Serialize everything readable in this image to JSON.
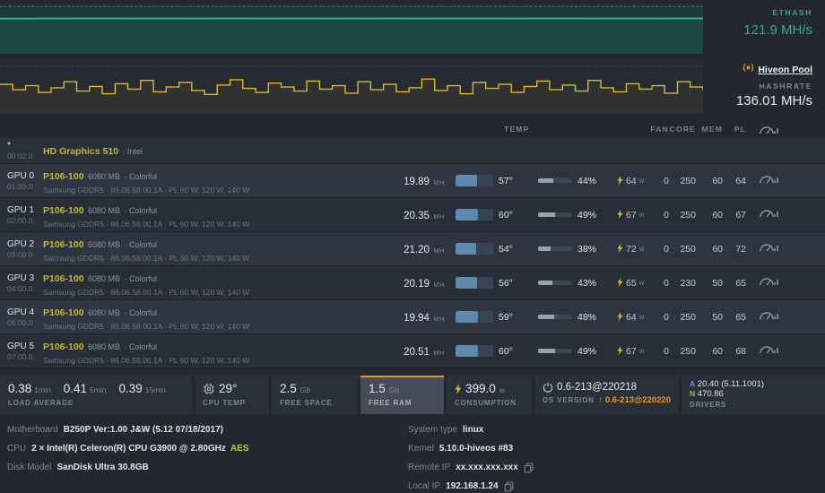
{
  "ethash": {
    "label": "ETHASH",
    "value": "121.9 MH/s",
    "chart": {
      "values": [
        121.5,
        122,
        121.8,
        122.2,
        121.9,
        122,
        121.7,
        122.1,
        121.9,
        122
      ],
      "ymin": 0,
      "ymax": 170,
      "color": "#2bb3a4",
      "fill": "rgba(43,179,164,0.12)"
    }
  },
  "pool": {
    "name": "Hiveon Pool",
    "hashrate_label": "HASHRATE",
    "hashrate": "136.01 MH/s",
    "chart": {
      "values": [
        139,
        131,
        137,
        127,
        134,
        143,
        129,
        136,
        125,
        140,
        132,
        145,
        128,
        135,
        142,
        130,
        124,
        138,
        146,
        133,
        127,
        141,
        135,
        129,
        144,
        132,
        137,
        126,
        143,
        131,
        139,
        128,
        134,
        147,
        130,
        137,
        125,
        142,
        133,
        139,
        127,
        136,
        144,
        131,
        138,
        129,
        145,
        134,
        128,
        140,
        132,
        137,
        126,
        143,
        135,
        130
      ],
      "ymin": 95,
      "ymax": 170,
      "color": "#e3b71c",
      "fill": "rgba(227,183,28,0.05)"
    }
  },
  "table": {
    "headers": {
      "temp": "TEMP",
      "fan": "FAN",
      "core": "CORE",
      "mem": "MEM",
      "pl": "PL"
    },
    "integrated": {
      "slot": "*",
      "bus": "00:02.0",
      "name": "HD Graphics 510",
      "vendor": "· Intel"
    },
    "gpus": [
      {
        "slot": "GPU 0",
        "bus": "01:00.0",
        "model": "P106-100",
        "memsize": "6080 MB",
        "brand": "· Colorful",
        "detail": "Samsung GDDR5 · 86.06.58.00.1A · PL 60 W, 120 W, 140 W",
        "hash": "19.89",
        "hash_unit": "MH",
        "temp": 57,
        "temp_label": "57°",
        "fan": 44,
        "fan_label": "44%",
        "power": "64",
        "power_unit": "w",
        "oc_fan": "0",
        "oc_core": "250",
        "oc_mem": "60",
        "oc_pl": "64"
      },
      {
        "slot": "GPU 1",
        "bus": "02:00.0",
        "model": "P106-100",
        "memsize": "6080 MB",
        "brand": "· Colorful",
        "detail": "Samsung GDDR5 · 86.06.58.00.1A · PL 60 W, 120 W, 140 W",
        "hash": "20.35",
        "hash_unit": "MH",
        "temp": 60,
        "temp_label": "60°",
        "fan": 49,
        "fan_label": "49%",
        "power": "67",
        "power_unit": "w",
        "oc_fan": "0",
        "oc_core": "250",
        "oc_mem": "60",
        "oc_pl": "67"
      },
      {
        "slot": "GPU 2",
        "bus": "03:00.0",
        "model": "P106-100",
        "memsize": "6080 MB",
        "brand": "· Colorful",
        "detail": "Samsung GDDR5 · 86.06.58.00.1A · PL 60 W, 120 W, 140 W",
        "hash": "21.20",
        "hash_unit": "MH",
        "temp": 54,
        "temp_label": "54°",
        "fan": 38,
        "fan_label": "38%",
        "power": "72",
        "power_unit": "w",
        "oc_fan": "0",
        "oc_core": "250",
        "oc_mem": "60",
        "oc_pl": "72"
      },
      {
        "slot": "GPU 3",
        "bus": "04:00.0",
        "model": "P106-100",
        "memsize": "6080 MB",
        "brand": "· Colorful",
        "detail": "Samsung GDDR5 · 86.06.58.00.1A · PL 60 W, 120 W, 140 W",
        "hash": "20.19",
        "hash_unit": "MH",
        "temp": 56,
        "temp_label": "56°",
        "fan": 43,
        "fan_label": "43%",
        "power": "65",
        "power_unit": "w",
        "oc_fan": "0",
        "oc_core": "230",
        "oc_mem": "50",
        "oc_pl": "65"
      },
      {
        "slot": "GPU 4",
        "bus": "06:00.0",
        "model": "P106-100",
        "memsize": "6080 MB",
        "brand": "· Colorful",
        "detail": "Samsung GDDR5 · 86.06.58.00.1A · PL 60 W, 120 W, 140 W",
        "hash": "19.94",
        "hash_unit": "MH",
        "temp": 59,
        "temp_label": "59°",
        "fan": 48,
        "fan_label": "48%",
        "power": "64",
        "power_unit": "w",
        "oc_fan": "0",
        "oc_core": "250",
        "oc_mem": "50",
        "oc_pl": "65"
      },
      {
        "slot": "GPU 5",
        "bus": "07:00.0",
        "model": "P106-100",
        "memsize": "6080 MB",
        "brand": "· Colorful",
        "detail": "Samsung GDDR5 · 86.06.58.00.1A · PL 60 W, 120 W, 140 W",
        "hash": "20.51",
        "hash_unit": "MH",
        "temp": 60,
        "temp_label": "60°",
        "fan": 49,
        "fan_label": "49%",
        "power": "67",
        "power_unit": "w",
        "oc_fan": "0",
        "oc_core": "250",
        "oc_mem": "60",
        "oc_pl": "68"
      }
    ]
  },
  "stats": {
    "load": {
      "label": "LOAD AVERAGE",
      "values": [
        {
          "v": "0.38",
          "u": "1min"
        },
        {
          "v": "0.41",
          "u": "5min"
        },
        {
          "v": "0.39",
          "u": "15min"
        }
      ]
    },
    "cpu_temp": {
      "label": "CPU TEMP",
      "value": "29°"
    },
    "free_space": {
      "label": "FREE SPACE",
      "value": "2.5",
      "unit": "Gb"
    },
    "free_ram": {
      "label": "FREE RAM",
      "value": "1.5",
      "unit": "Gb"
    },
    "consumption": {
      "label": "CONSUMPTION",
      "value": "399.0",
      "unit": "w"
    },
    "os": {
      "label": "OS VERSION",
      "value": "0.6-213@220218",
      "upgrade": "0.6-213@220220"
    },
    "drivers": {
      "label": "DRIVERS",
      "amd_letter": "A",
      "amd_version": "20.40 (5.11.1001)",
      "nvidia_letter": "N",
      "nvidia_version": "470.86"
    }
  },
  "info": {
    "left": [
      {
        "label": "Motherboard",
        "value": "B250P Ver:1.00 J&W (5.12 07/18/2017)"
      },
      {
        "label": "CPU",
        "value": "2 × Intel(R) Celeron(R) CPU G3900 @ 2.80GHz",
        "badge": "AES"
      },
      {
        "label": "Disk Model",
        "value": "SanDisk Ultra 30.8GB"
      }
    ],
    "right": [
      {
        "label": "System type",
        "value": "linux"
      },
      {
        "label": "Kernel",
        "value": "5.10.0-hiveos #83"
      },
      {
        "label": "Remote IP",
        "value": "xx.xxx.xxx.xxx"
      },
      {
        "label": "Local IP",
        "value": "192.168.1.24"
      }
    ]
  },
  "colors": {
    "accent_teal": "#2fa99b",
    "accent_yellow": "#e3b71c",
    "accent_orange": "#f09819",
    "amd_purple": "#9b7fd4",
    "nvidia_green": "#8bc34a"
  }
}
